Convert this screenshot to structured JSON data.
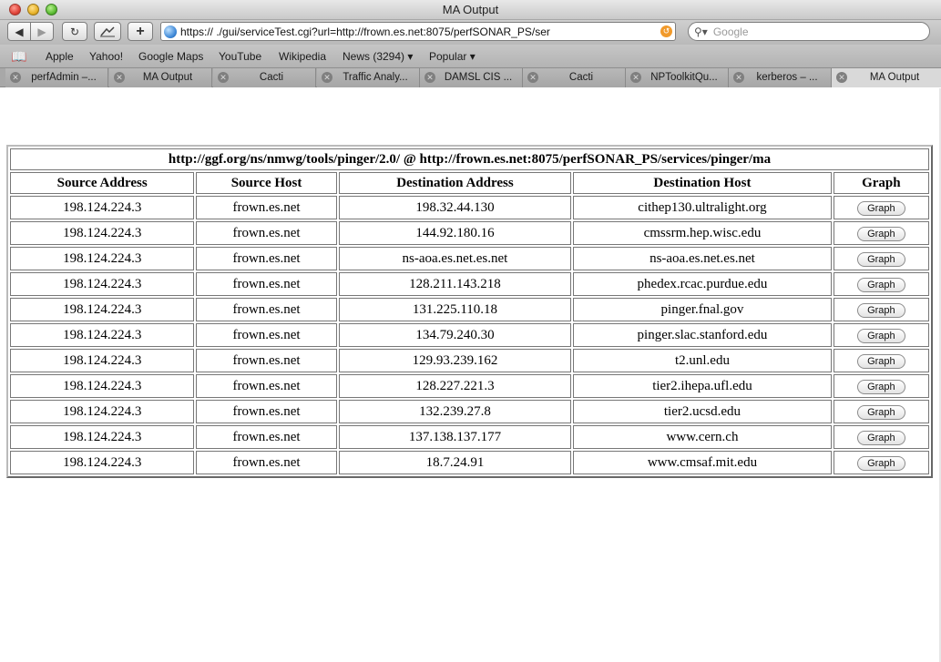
{
  "window": {
    "title": "MA Output"
  },
  "toolbar": {
    "back": "◀",
    "forward": "▶",
    "reload": "↻",
    "add": "+",
    "url": "https://          ./gui/serviceTest.cgi?url=http://frown.es.net:8075/perfSONAR_PS/ser",
    "search_placeholder": "Google"
  },
  "bookmarks": [
    "Apple",
    "Yahoo!",
    "Google Maps",
    "YouTube",
    "Wikipedia",
    "News (3294) ▾",
    "Popular ▾"
  ],
  "tabs": [
    "perfAdmin –...",
    "MA Output",
    "Cacti",
    "Traffic Analy...",
    "DAMSL CIS ...",
    "Cacti",
    "NPToolkitQu...",
    "kerberos – ...",
    "MA Output"
  ],
  "table": {
    "caption": "http://ggf.org/ns/nmwg/tools/pinger/2.0/ @ http://frown.es.net:8075/perfSONAR_PS/services/pinger/ma",
    "headers": [
      "Source Address",
      "Source Host",
      "Destination Address",
      "Destination Host",
      "Graph"
    ],
    "button_label": "Graph",
    "rows": [
      [
        "198.124.224.3",
        "frown.es.net",
        "198.32.44.130",
        "cithep130.ultralight.org"
      ],
      [
        "198.124.224.3",
        "frown.es.net",
        "144.92.180.16",
        "cmssrm.hep.wisc.edu"
      ],
      [
        "198.124.224.3",
        "frown.es.net",
        "ns-aoa.es.net.es.net",
        "ns-aoa.es.net.es.net"
      ],
      [
        "198.124.224.3",
        "frown.es.net",
        "128.211.143.218",
        "phedex.rcac.purdue.edu"
      ],
      [
        "198.124.224.3",
        "frown.es.net",
        "131.225.110.18",
        "pinger.fnal.gov"
      ],
      [
        "198.124.224.3",
        "frown.es.net",
        "134.79.240.30",
        "pinger.slac.stanford.edu"
      ],
      [
        "198.124.224.3",
        "frown.es.net",
        "129.93.239.162",
        "t2.unl.edu"
      ],
      [
        "198.124.224.3",
        "frown.es.net",
        "128.227.221.3",
        "tier2.ihepa.ufl.edu"
      ],
      [
        "198.124.224.3",
        "frown.es.net",
        "132.239.27.8",
        "tier2.ucsd.edu"
      ],
      [
        "198.124.224.3",
        "frown.es.net",
        "137.138.137.177",
        "www.cern.ch"
      ],
      [
        "198.124.224.3",
        "frown.es.net",
        "18.7.24.91",
        "www.cmsaf.mit.edu"
      ]
    ]
  }
}
